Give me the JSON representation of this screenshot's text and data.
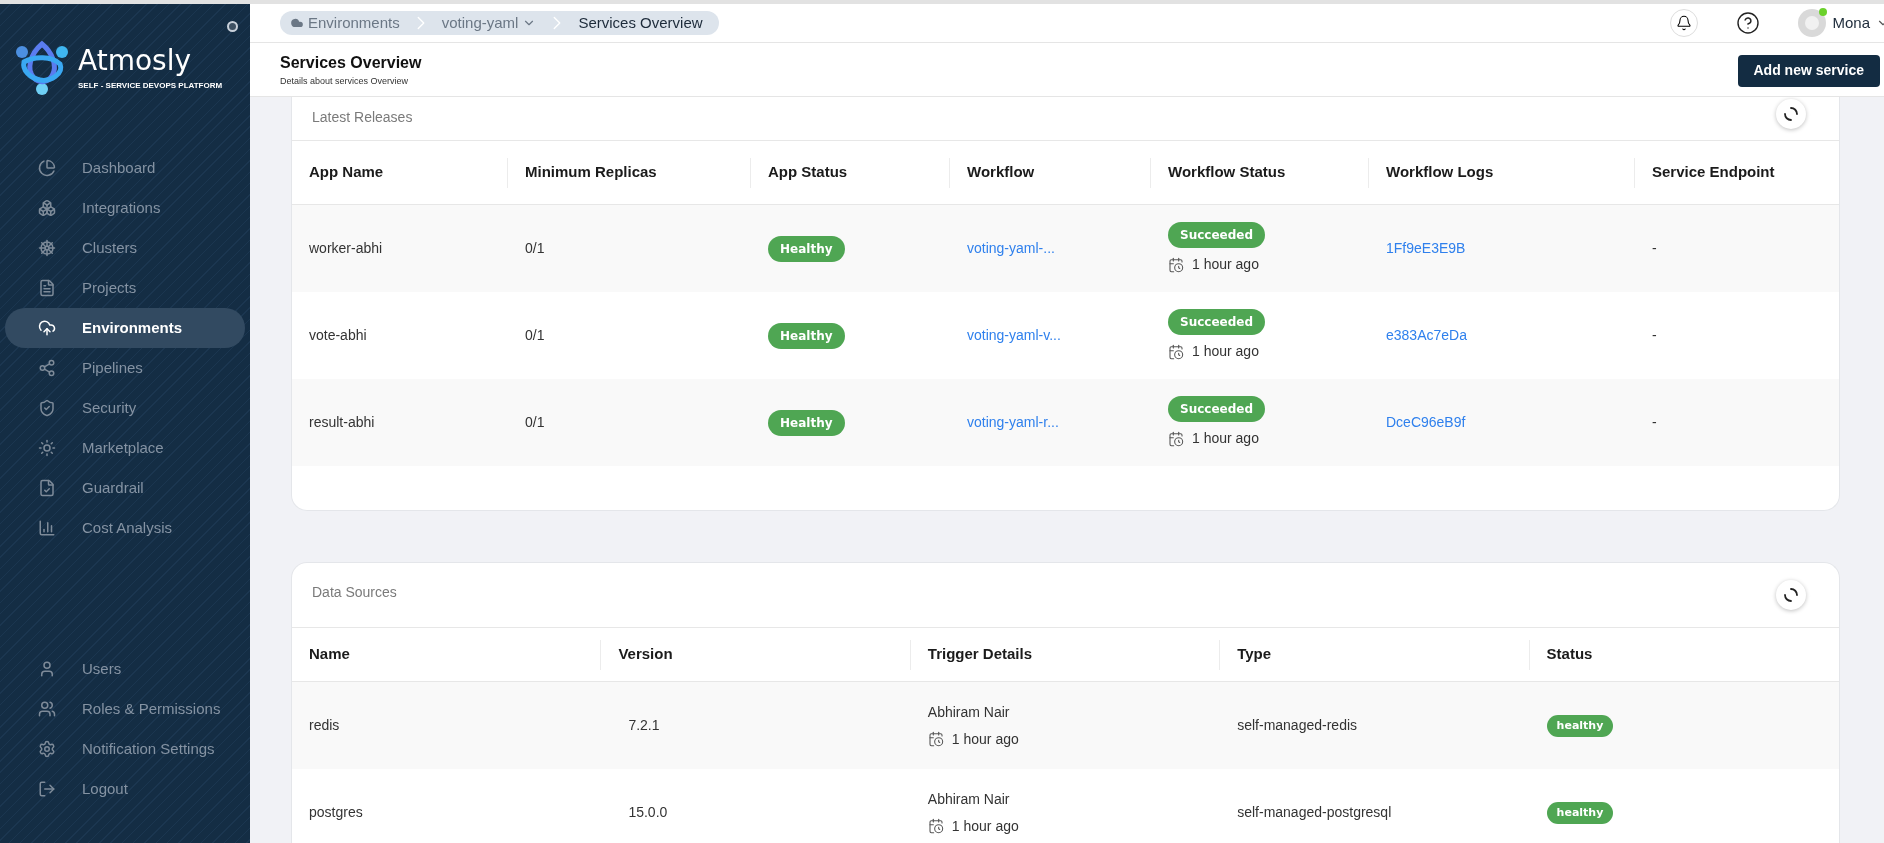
{
  "sidebar": {
    "brand": "Atmosly",
    "tagline": "SELF - SERVICE DEVOPS PLATFORM",
    "items": [
      {
        "label": "Dashboard",
        "selected": false
      },
      {
        "label": "Integrations",
        "selected": false
      },
      {
        "label": "Clusters",
        "selected": false
      },
      {
        "label": "Projects",
        "selected": false
      },
      {
        "label": "Environments",
        "selected": true
      },
      {
        "label": "Pipelines",
        "selected": false
      },
      {
        "label": "Security",
        "selected": false
      },
      {
        "label": "Marketplace",
        "selected": false
      },
      {
        "label": "Guardrail",
        "selected": false
      },
      {
        "label": "Cost Analysis",
        "selected": false
      }
    ],
    "footer_items": [
      {
        "label": "Users"
      },
      {
        "label": "Roles & Permissions"
      },
      {
        "label": "Notification Settings"
      },
      {
        "label": "Logout"
      }
    ]
  },
  "breadcrumb": [
    {
      "label": "Environments",
      "kind": "root"
    },
    {
      "label": "voting-yaml",
      "kind": "dropdown"
    },
    {
      "label": "Services Overview",
      "kind": "current"
    }
  ],
  "user": {
    "name": "Mona",
    "online": true
  },
  "page": {
    "title": "Services Overview",
    "subtitle": "Details about services Overview",
    "action": "Add new service"
  },
  "releases": {
    "title": "Latest Releases",
    "columns": [
      "App Name",
      "Minimum Replicas",
      "App Status",
      "Workflow",
      "Workflow Status",
      "Workflow Logs",
      "Service Endpoint"
    ],
    "rows": [
      {
        "app_name": "worker-abhi",
        "minimum_replicas": "0/1",
        "app_status": "Healthy",
        "workflow": "voting-yaml-...",
        "workflow_status": "Succeeded",
        "workflow_time": "1 hour ago",
        "workflow_logs": "1Ff9eE3E9B",
        "service_endpoint": "-"
      },
      {
        "app_name": "vote-abhi",
        "minimum_replicas": "0/1",
        "app_status": "Healthy",
        "workflow": "voting-yaml-v...",
        "workflow_status": "Succeeded",
        "workflow_time": "1 hour ago",
        "workflow_logs": "e383Ac7eDa",
        "service_endpoint": "-"
      },
      {
        "app_name": "result-abhi",
        "minimum_replicas": "0/1",
        "app_status": "Healthy",
        "workflow": "voting-yaml-r...",
        "workflow_status": "Succeeded",
        "workflow_time": "1 hour ago",
        "workflow_logs": "DceC96eB9f",
        "service_endpoint": "-"
      }
    ]
  },
  "data_sources": {
    "title": "Data Sources",
    "columns": [
      "Name",
      "Version",
      "Trigger Details",
      "Type",
      "Status"
    ],
    "rows": [
      {
        "name": "redis",
        "version": "7.2.1",
        "triggered_by": "Abhiram Nair",
        "time": "1 hour ago",
        "type": "self-managed-redis",
        "status": "healthy"
      },
      {
        "name": "postgres",
        "version": "15.0.0",
        "triggered_by": "Abhiram Nair",
        "time": "1 hour ago",
        "type": "self-managed-postgresql",
        "status": "healthy"
      }
    ]
  }
}
